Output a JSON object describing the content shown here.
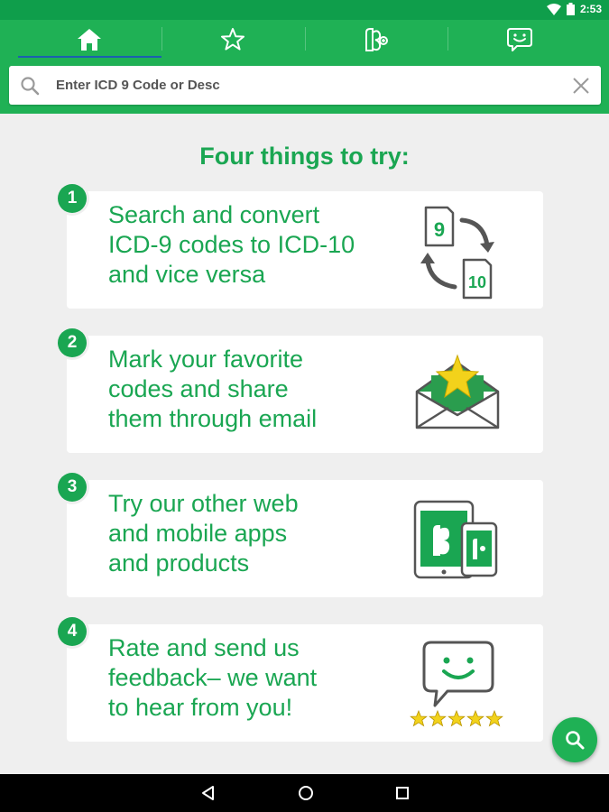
{
  "status": {
    "time": "2:53"
  },
  "tabs": [
    {
      "icon": "home-icon",
      "active": true
    },
    {
      "icon": "star-icon",
      "active": false
    },
    {
      "icon": "apps-icon",
      "active": false
    },
    {
      "icon": "feedback-icon",
      "active": false
    }
  ],
  "search": {
    "placeholder": "Enter ICD 9 Code or Desc",
    "value": ""
  },
  "main": {
    "heading": "Four things to try:",
    "items": [
      {
        "number": "1",
        "text": "Search and convert\nICD-9 codes to ICD-10\nand vice versa",
        "icon": "convert-codes-icon",
        "labels": [
          "9",
          "10"
        ]
      },
      {
        "number": "2",
        "text": "Mark your favorite\ncodes and share\nthem through email",
        "icon": "email-star-icon"
      },
      {
        "number": "3",
        "text": "Try our other web\nand mobile apps\nand products",
        "icon": "devices-icon"
      },
      {
        "number": "4",
        "text": "Rate and send us\nfeedback– we want\nto hear from you!",
        "icon": "rating-feedback-icon"
      }
    ]
  },
  "colors": {
    "brand": "#1fb155",
    "status_bar": "#0f9e4b",
    "accent_text": "#1aa652",
    "star": "#f2d21b"
  }
}
